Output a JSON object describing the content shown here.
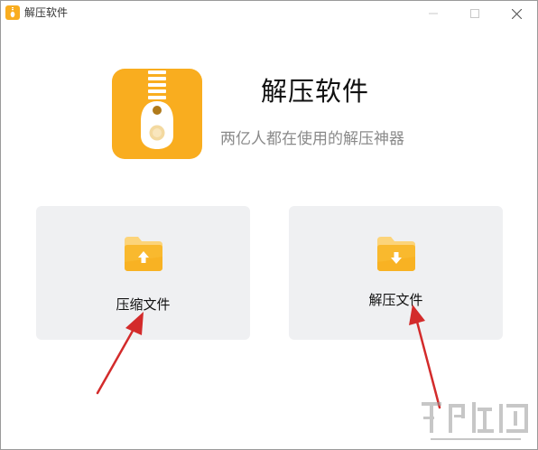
{
  "window": {
    "title": "解压软件",
    "controls": {
      "minimize": "minimize",
      "maximize": "maximize",
      "close": "close"
    }
  },
  "hero": {
    "title": "解压软件",
    "subtitle": "两亿人都在使用的解压神器",
    "icon": "zipper-icon",
    "accent_color": "#f9ad1f"
  },
  "actions": [
    {
      "label": "压缩文件",
      "icon": "folder-upload-icon"
    },
    {
      "label": "解压文件",
      "icon": "folder-download-icon"
    }
  ],
  "annotation": {
    "arrow_color": "#d32b2b"
  },
  "colors": {
    "card_background": "#eff0f2",
    "folder_front": "#f9b92e",
    "folder_back": "#fcd47a"
  }
}
